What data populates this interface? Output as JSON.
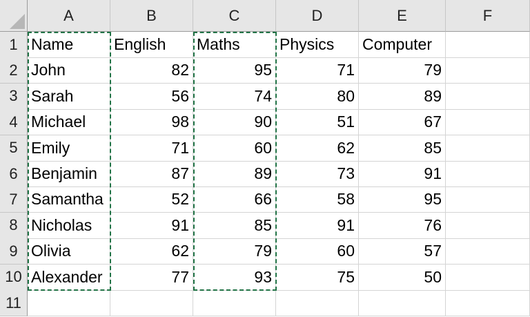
{
  "columns": [
    "A",
    "B",
    "C",
    "D",
    "E",
    "F"
  ],
  "rows": [
    "1",
    "2",
    "3",
    "4",
    "5",
    "6",
    "7",
    "8",
    "9",
    "10",
    "11"
  ],
  "cells": [
    [
      "Name",
      "English",
      "Maths",
      "Physics",
      "Computer",
      ""
    ],
    [
      "John",
      "82",
      "95",
      "71",
      "79",
      ""
    ],
    [
      "Sarah",
      "56",
      "74",
      "80",
      "89",
      ""
    ],
    [
      "Michael",
      "98",
      "90",
      "51",
      "67",
      ""
    ],
    [
      "Emily",
      "71",
      "60",
      "62",
      "85",
      ""
    ],
    [
      "Benjamin",
      "87",
      "89",
      "73",
      "91",
      ""
    ],
    [
      "Samantha",
      "52",
      "66",
      "58",
      "95",
      ""
    ],
    [
      "Nicholas",
      "91",
      "85",
      "91",
      "76",
      ""
    ],
    [
      "Olivia",
      "62",
      "79",
      "60",
      "57",
      ""
    ],
    [
      "Alexander",
      "77",
      "93",
      "75",
      "50",
      ""
    ],
    [
      "",
      "",
      "",
      "",
      "",
      ""
    ]
  ],
  "copy_selection": {
    "ranges": [
      "A1:A10",
      "C1:C10"
    ],
    "color": "#217346"
  },
  "colors": {
    "header_bg": "#e6e6e6",
    "gridline": "#d4d4d4"
  }
}
